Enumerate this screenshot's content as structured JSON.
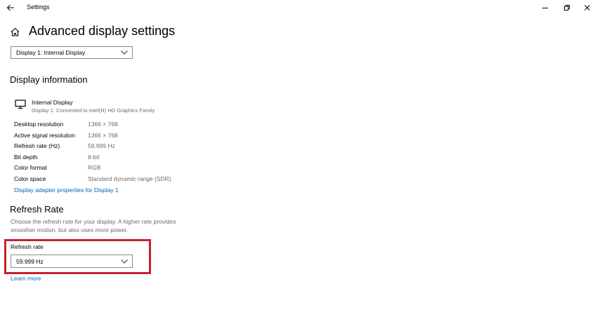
{
  "window": {
    "title": "Settings",
    "controls": {
      "minimize": "minimize-icon",
      "restore": "restore-icon",
      "close": "close-icon"
    }
  },
  "page": {
    "title": "Advanced display settings"
  },
  "display_select": {
    "value": "Display 1: Internal Display"
  },
  "display_info": {
    "heading": "Display information",
    "display_name": "Internal Display",
    "display_subtitle": "Display 1: Connected to Intel(R) HD Graphics Family",
    "rows": [
      {
        "label": "Desktop resolution",
        "value": "1366 × 768"
      },
      {
        "label": "Active signal resolution",
        "value": "1366 × 768"
      },
      {
        "label": "Refresh rate (Hz)",
        "value": "59.999 Hz"
      },
      {
        "label": "Bit depth",
        "value": "8-bit"
      },
      {
        "label": "Color format",
        "value": "RGB"
      },
      {
        "label": "Color space",
        "value": "Standard dynamic range (SDR)"
      }
    ],
    "adapter_link": "Display adapter properties for Display 1"
  },
  "refresh_rate": {
    "heading": "Refresh Rate",
    "description": "Choose the refresh rate for your display. A higher rate provides smoother motion, but also uses more power.",
    "field_label": "Refresh rate",
    "value": "59.999 Hz",
    "learn_more": "Learn more"
  },
  "colors": {
    "accent": "#0067b8",
    "highlight": "#c8202f",
    "secondary_text": "#6b6b6b"
  }
}
